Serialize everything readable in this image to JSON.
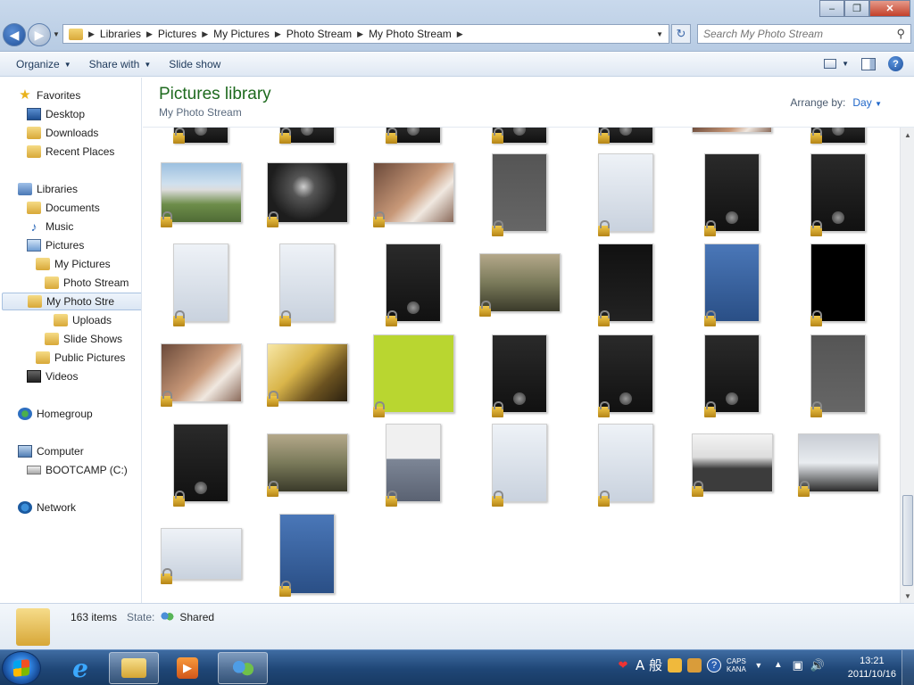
{
  "address": {
    "crumbs": [
      "Libraries",
      "Pictures",
      "My Pictures",
      "Photo Stream",
      "My Photo Stream"
    ]
  },
  "search": {
    "placeholder": "Search My Photo Stream"
  },
  "toolbar": {
    "organize": "Organize",
    "share_with": "Share with",
    "slide_show": "Slide show"
  },
  "nav": {
    "favorites": "Favorites",
    "desktop": "Desktop",
    "downloads": "Downloads",
    "recent_places": "Recent Places",
    "libraries": "Libraries",
    "documents": "Documents",
    "music": "Music",
    "pictures": "Pictures",
    "my_pictures": "My Pictures",
    "photo_stream": "Photo Stream",
    "my_photo_stream": "My Photo Stre",
    "uploads": "Uploads",
    "slide_shows": "Slide Shows",
    "public_pictures": "Public Pictures",
    "videos": "Videos",
    "homegroup": "Homegroup",
    "computer": "Computer",
    "bootcamp": "BOOTCAMP (C:)",
    "network": "Network"
  },
  "library": {
    "title": "Pictures library",
    "subtitle": "My Photo Stream",
    "arrange_label": "Arrange by:",
    "arrange_value": "Day"
  },
  "details": {
    "count": "163 items",
    "state_label": "State:",
    "state_value": "Shared"
  },
  "taskbar": {
    "ime": "A 般",
    "caps": "CAPS",
    "kana": "KANA",
    "time": "13:21",
    "date": "2011/10/16"
  }
}
